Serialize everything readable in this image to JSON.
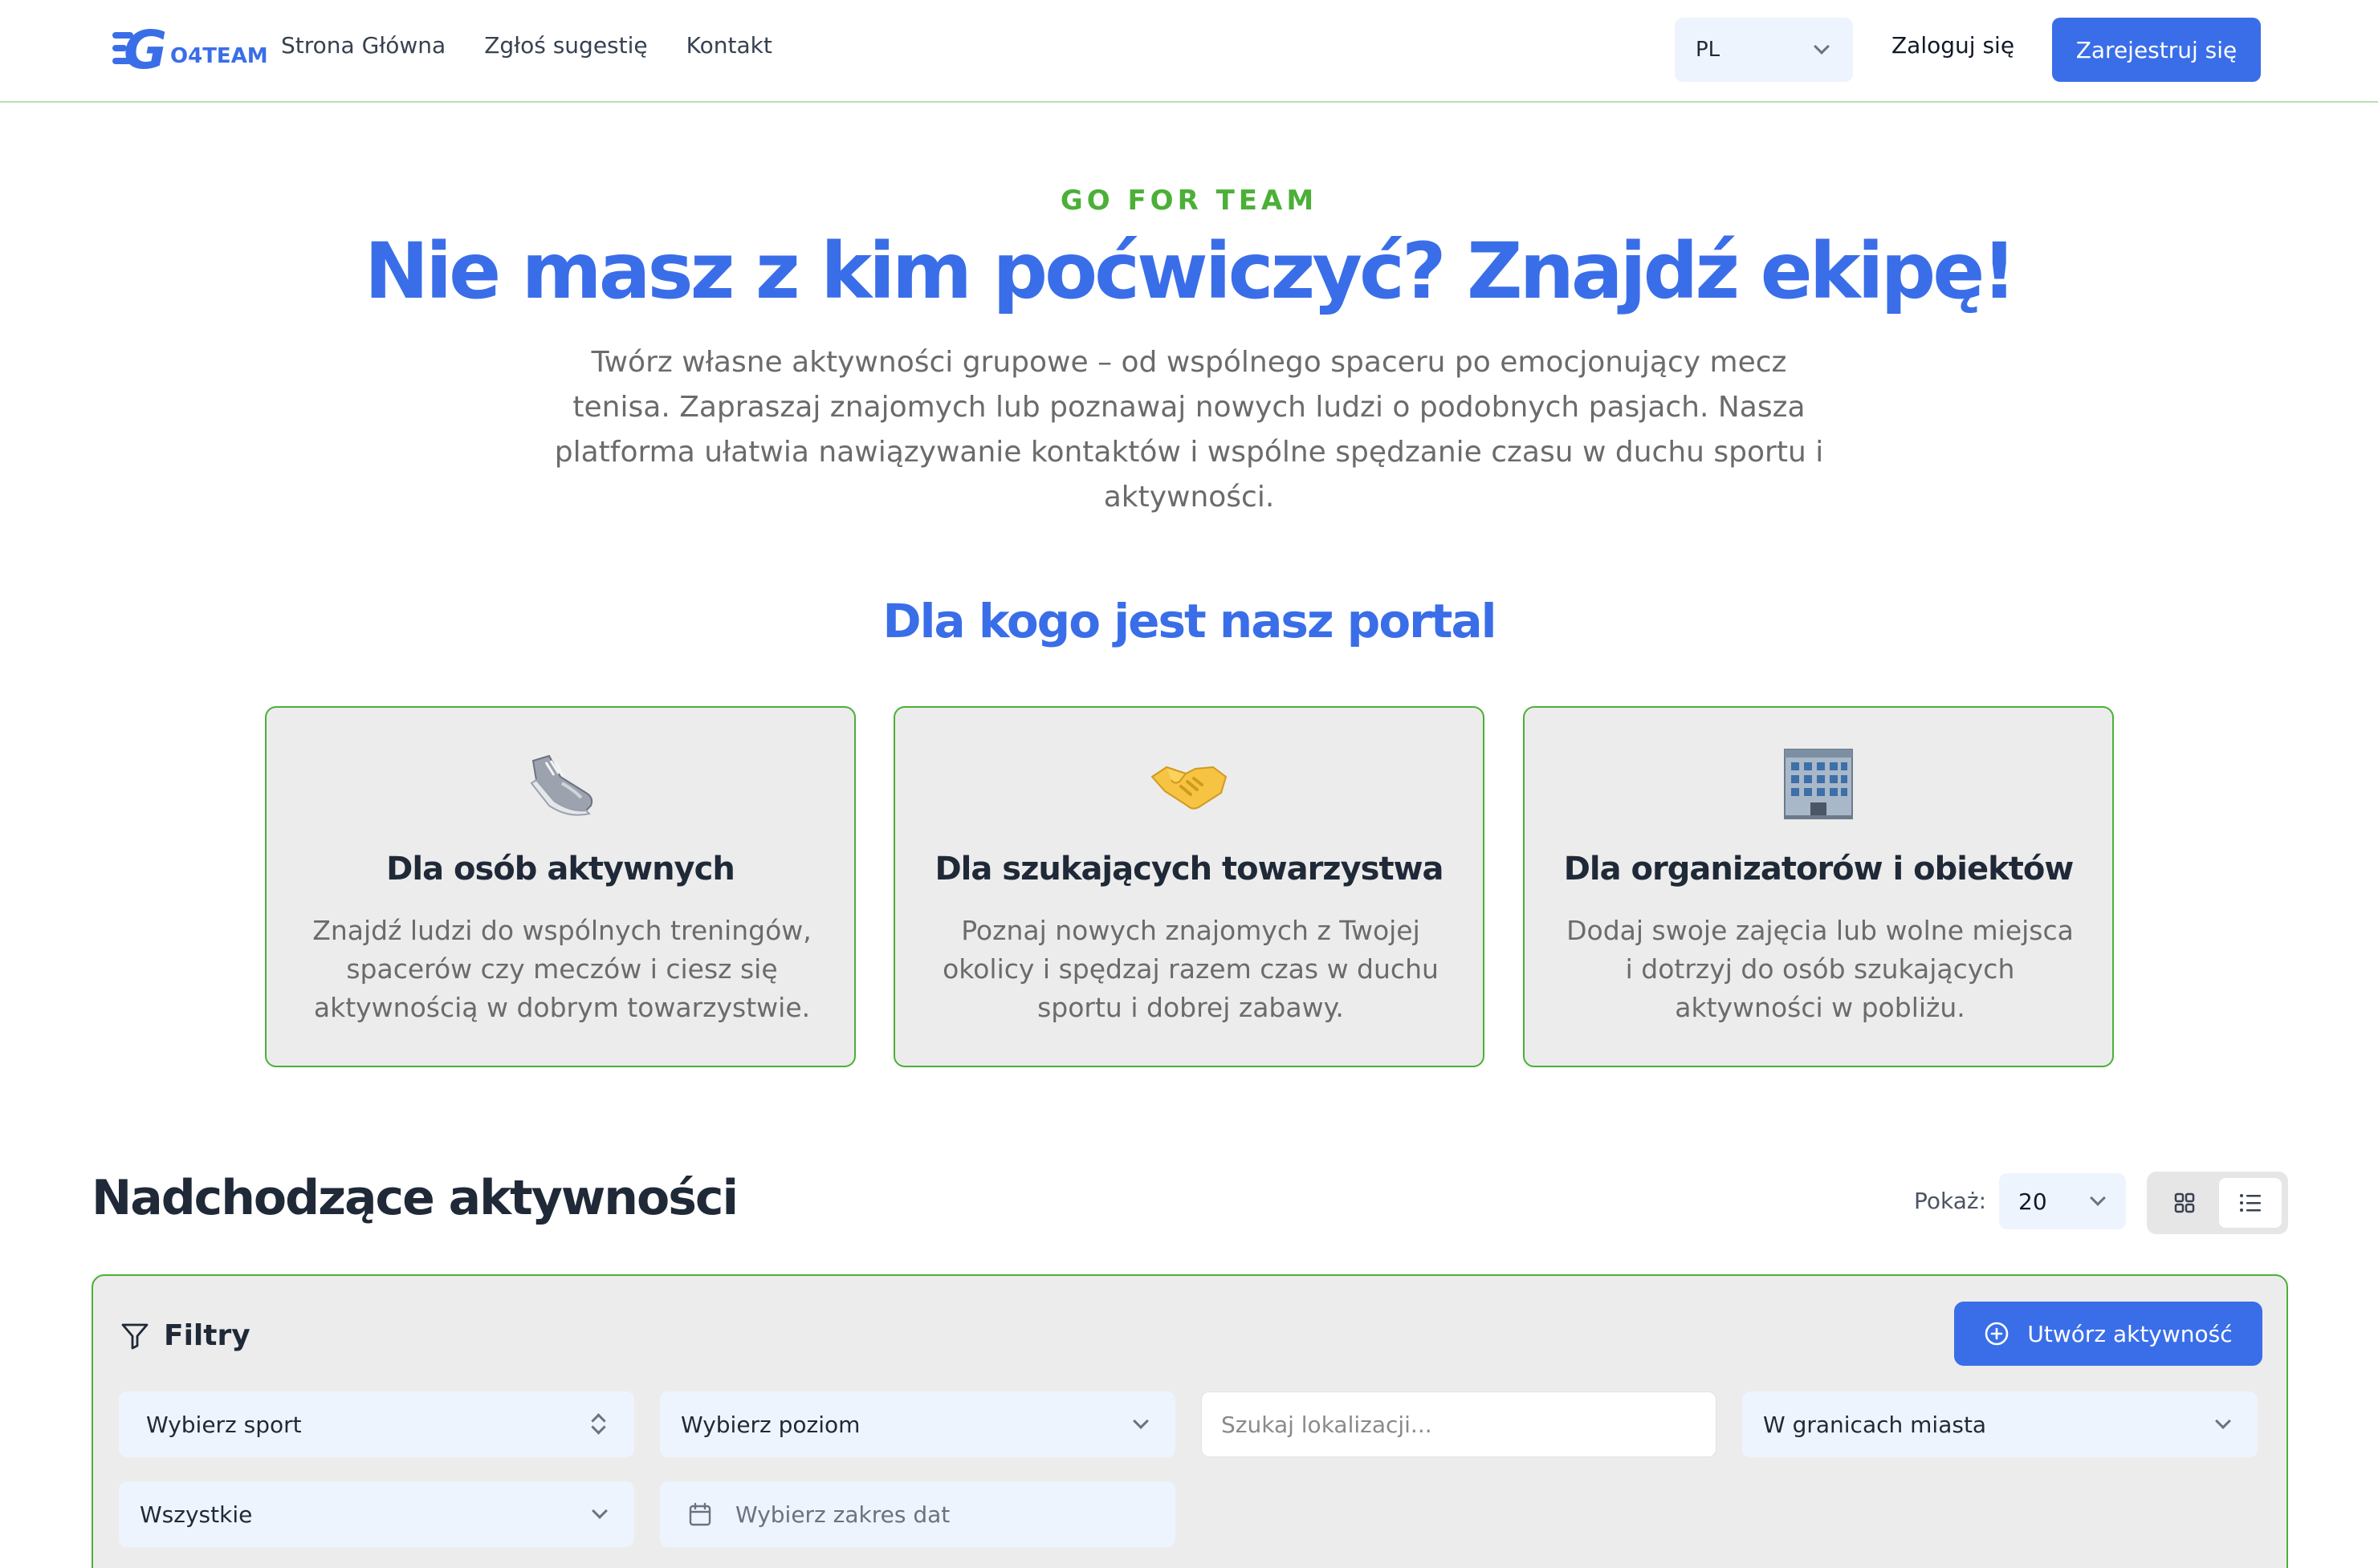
{
  "brand": {
    "logo_letter": "G",
    "logo_text": "O4TEAM"
  },
  "nav": {
    "links": [
      "Strona Główna",
      "Zgłoś sugestię",
      "Kontakt"
    ],
    "language": "PL",
    "login": "Zaloguj się",
    "register": "Zarejestruj się"
  },
  "hero": {
    "eyebrow": "GO FOR TEAM",
    "title": "Nie masz z kim poćwiczyć? Znajdź ekipę!",
    "text": "Twórz własne aktywności grupowe – od wspólnego spaceru po emocjonujący mecz tenisa. Zapraszaj znajomych lub poznawaj nowych ludzi o podobnych pasjach. Nasza platforma ułatwia nawiązywanie kontaktów i wspólne spędzanie czasu w duchu sportu i aktywności."
  },
  "audience": {
    "title": "Dla kogo jest nasz portal",
    "cards": [
      {
        "icon": "sneaker-icon",
        "title": "Dla osób aktywnych",
        "text": "Znajdź ludzi do wspólnych treningów, spacerów czy meczów i ciesz się aktywnością w dobrym towarzystwie."
      },
      {
        "icon": "handshake-icon",
        "title": "Dla szukających towarzystwa",
        "text": "Poznaj nowych znajomych z Twojej okolicy i spędzaj razem czas w duchu sportu i dobrej zabawy."
      },
      {
        "icon": "building-icon",
        "title": "Dla organizatorów i obiektów",
        "text": "Dodaj swoje zajęcia lub wolne miejsca i dotrzyj do osób szukających aktywności w pobliżu."
      }
    ]
  },
  "upcoming": {
    "title": "Nadchodzące aktywności",
    "show_label": "Pokaż:",
    "show_value": "20"
  },
  "filters": {
    "title": "Filtry",
    "create_button": "Utwórz aktywność",
    "sport": "Wybierz sport",
    "level": "Wybierz poziom",
    "location_placeholder": "Szukaj lokalizacji...",
    "city_scope": "W granicach miasta",
    "type": "Wszystkie",
    "date_placeholder": "Wybierz zakres dat"
  },
  "colors": {
    "primary": "#3a6ee8",
    "accent_green": "#4caf38",
    "card_bg": "#ececec",
    "input_bg": "#eef4fd"
  }
}
